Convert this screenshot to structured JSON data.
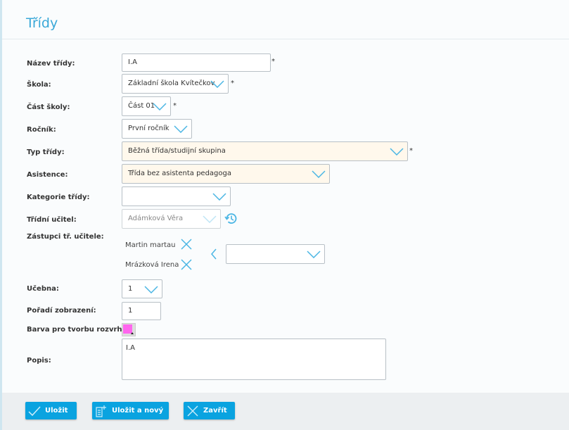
{
  "title": "Třídy",
  "form": {
    "nazev": {
      "label": "Název třídy:",
      "value": "I.A",
      "required": "*"
    },
    "skola": {
      "label": "Škola:",
      "value": "Základní škola Kvítečkov",
      "required": "*"
    },
    "cast": {
      "label": "Část školy:",
      "value": "Část 01",
      "required": "*"
    },
    "rocnik": {
      "label": "Ročník:",
      "value": "První ročník"
    },
    "typ": {
      "label": "Typ třídy:",
      "value": "Běžná třída/studijní skupina",
      "required": "*"
    },
    "asistence": {
      "label": "Asistence:",
      "value": "Třída bez asistenta pedagoga"
    },
    "kategorie": {
      "label": "Kategorie třídy:",
      "value": ""
    },
    "tridni": {
      "label": "Třídní učitel:",
      "value": "Adámková Věra"
    },
    "zastupci": {
      "label": "Zástupci tř. učitele:",
      "items": [
        "Martin martau",
        "Mrázková Irena"
      ],
      "select_value": ""
    },
    "ucebna": {
      "label": "Učebna:",
      "value": "1"
    },
    "poradi": {
      "label": "Pořadí zobrazení:",
      "value": "1"
    },
    "barva": {
      "label": "Barva pro tvorbu rozvrhu:",
      "color": "#ff66ee"
    },
    "popis": {
      "label": "Popis:",
      "value": "I.A"
    }
  },
  "buttons": {
    "save": "Uložit",
    "save_new": "Uložit a nový",
    "close": "Zavřít"
  },
  "colors": {
    "accent": "#0aa3e0",
    "highlight_field": "#fff8ec"
  }
}
